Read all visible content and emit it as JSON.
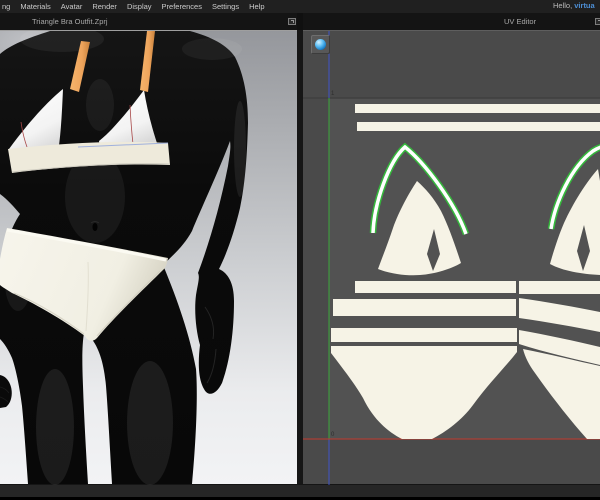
{
  "menu": {
    "items": [
      "ng",
      "Materials",
      "Avatar",
      "Render",
      "Display",
      "Preferences",
      "Settings",
      "Help"
    ]
  },
  "greeting": {
    "prefix": "Hello, ",
    "user": "virtua"
  },
  "panels": {
    "left": {
      "title": "Triangle Bra Outfit.Zprj"
    },
    "right": {
      "title": "UV Editor"
    }
  },
  "uv_editor": {
    "axis_labels": {
      "v_max": "1",
      "origin": "0"
    },
    "pieces": [
      "strap-band-top-1",
      "strap-band-top-2",
      "left-cup-trim-arc",
      "left-cup",
      "band-strip-1",
      "band-strip-2",
      "band-strip-3",
      "panty-front",
      "right-cup-trim-arc",
      "right-cup",
      "back-strip-1",
      "back-strip-2",
      "back-strip-3",
      "panty-back"
    ]
  },
  "scene": {
    "garment": [
      "triangle-bra-left-cup",
      "triangle-bra-right-cup",
      "bra-underband",
      "bra-strap-left",
      "bra-strap-right",
      "panty"
    ]
  },
  "icons": {
    "texture_sphere": "blue-sphere-icon",
    "panel_float": "float-window-icon"
  },
  "colors": {
    "uv_bg_outside": "#4a4a4a",
    "uv_bg_inside": "#525252",
    "pattern_cream": "#f6f3e6",
    "arc_green": "#35b93c",
    "axis_green": "#3aa83a",
    "axis_red": "#c23b2e",
    "axis_blue": "#4054c8",
    "strap_orange": "#eea45c",
    "accent_blue_text": "#4d8fd6"
  }
}
